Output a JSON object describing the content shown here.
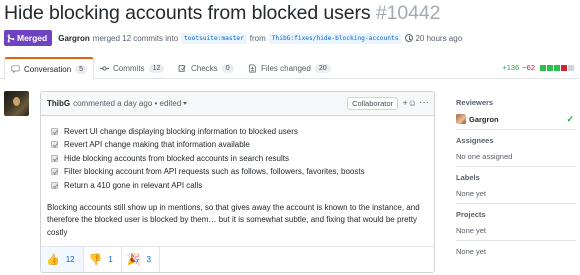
{
  "pr": {
    "title": "Hide blocking accounts from blocked users",
    "number": "#10442",
    "status": "Merged",
    "author": "Gargron",
    "merge_text": "merged 12 commits into",
    "base_branch": "tootsuite:master",
    "from_word": "from",
    "head_branch": "ThibG:fixes/hide-blocking-accounts",
    "time": "20 hours ago"
  },
  "tabs": [
    {
      "label": "Conversation",
      "count": "5"
    },
    {
      "label": "Commits",
      "count": "12"
    },
    {
      "label": "Checks",
      "count": "0"
    },
    {
      "label": "Files changed",
      "count": "20"
    }
  ],
  "diffstat": {
    "additions": "+136",
    "deletions": "−62"
  },
  "comment": {
    "author": "ThibG",
    "meta": "commented a day ago • edited",
    "role_badge": "Collaborator",
    "tasks": [
      "Revert UI change displaying blocking information to blocked users",
      "Revert API change making that information available",
      "Hide blocking accounts from blocked accounts in search results",
      "Filter blocking account from API requests such as follows, followers, favorites, boosts",
      "Return a 410 gone in relevant API calls"
    ],
    "body": "Blocking accounts still show up in mentions, so that gives away the account is known to the instance, and therefore the blocked user is blocked by them… but it is somewhat subtle, and fixing that would be pretty costly",
    "reactions": [
      {
        "emoji": "thumbs-up",
        "glyph": "👍",
        "count": "12"
      },
      {
        "emoji": "thumbs-down",
        "glyph": "👎",
        "count": "1"
      },
      {
        "emoji": "tada",
        "glyph": "🎉",
        "count": "3"
      }
    ]
  },
  "sidebar": {
    "reviewers_label": "Reviewers",
    "reviewer": "Gargron",
    "assignees_label": "Assignees",
    "assignees_value": "No one assigned",
    "labels_label": "Labels",
    "labels_value": "None yet",
    "projects_label": "Projects",
    "projects_value": "None yet",
    "milestone_value": "None yet"
  },
  "colors": {
    "merged": "#6f42c1",
    "additions": "#28a745",
    "deletions": "#cb2431",
    "link": "#0366d6",
    "active_tab_border": "#e36209"
  }
}
